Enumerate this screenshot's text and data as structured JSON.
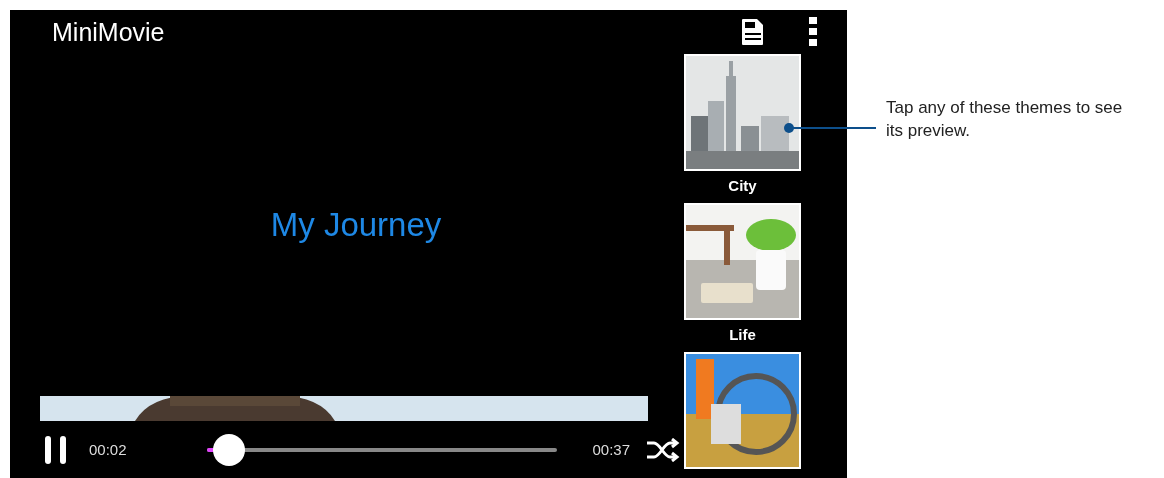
{
  "app_bar": {
    "title": "MiniMovie"
  },
  "preview": {
    "title": "My Journey"
  },
  "player": {
    "playing": true,
    "elapsed": "00:02",
    "duration": "00:37",
    "level": 0.065
  },
  "themes": [
    {
      "label": "City",
      "kind": "city"
    },
    {
      "label": "Life",
      "kind": "life"
    },
    {
      "kind": "bike"
    }
  ],
  "callout": {
    "text": "Tap any of these themes to see its preview."
  }
}
